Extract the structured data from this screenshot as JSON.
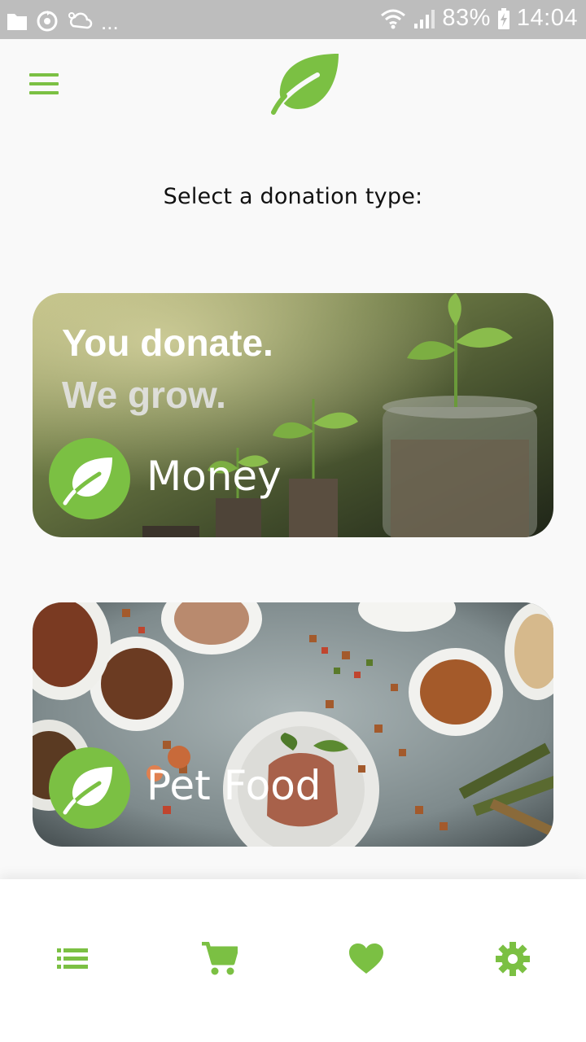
{
  "status_bar": {
    "dots": "...",
    "battery": "83%",
    "time": "14:04"
  },
  "header": {
    "menu_icon": "hamburger-menu-icon",
    "logo_icon": "leaf-icon"
  },
  "title": "Select a donation type:",
  "cards": [
    {
      "label": "Money",
      "slogan_line1": "You donate.",
      "slogan_line2": "We grow."
    },
    {
      "label": "Pet Food"
    }
  ],
  "bottom_nav": {
    "items": [
      "list-icon",
      "cart-icon",
      "heart-icon",
      "settings-gear-icon"
    ]
  },
  "colors": {
    "accent": "#7bc043",
    "status_bar": "#bdbdbd",
    "background": "#f9f9f9"
  }
}
